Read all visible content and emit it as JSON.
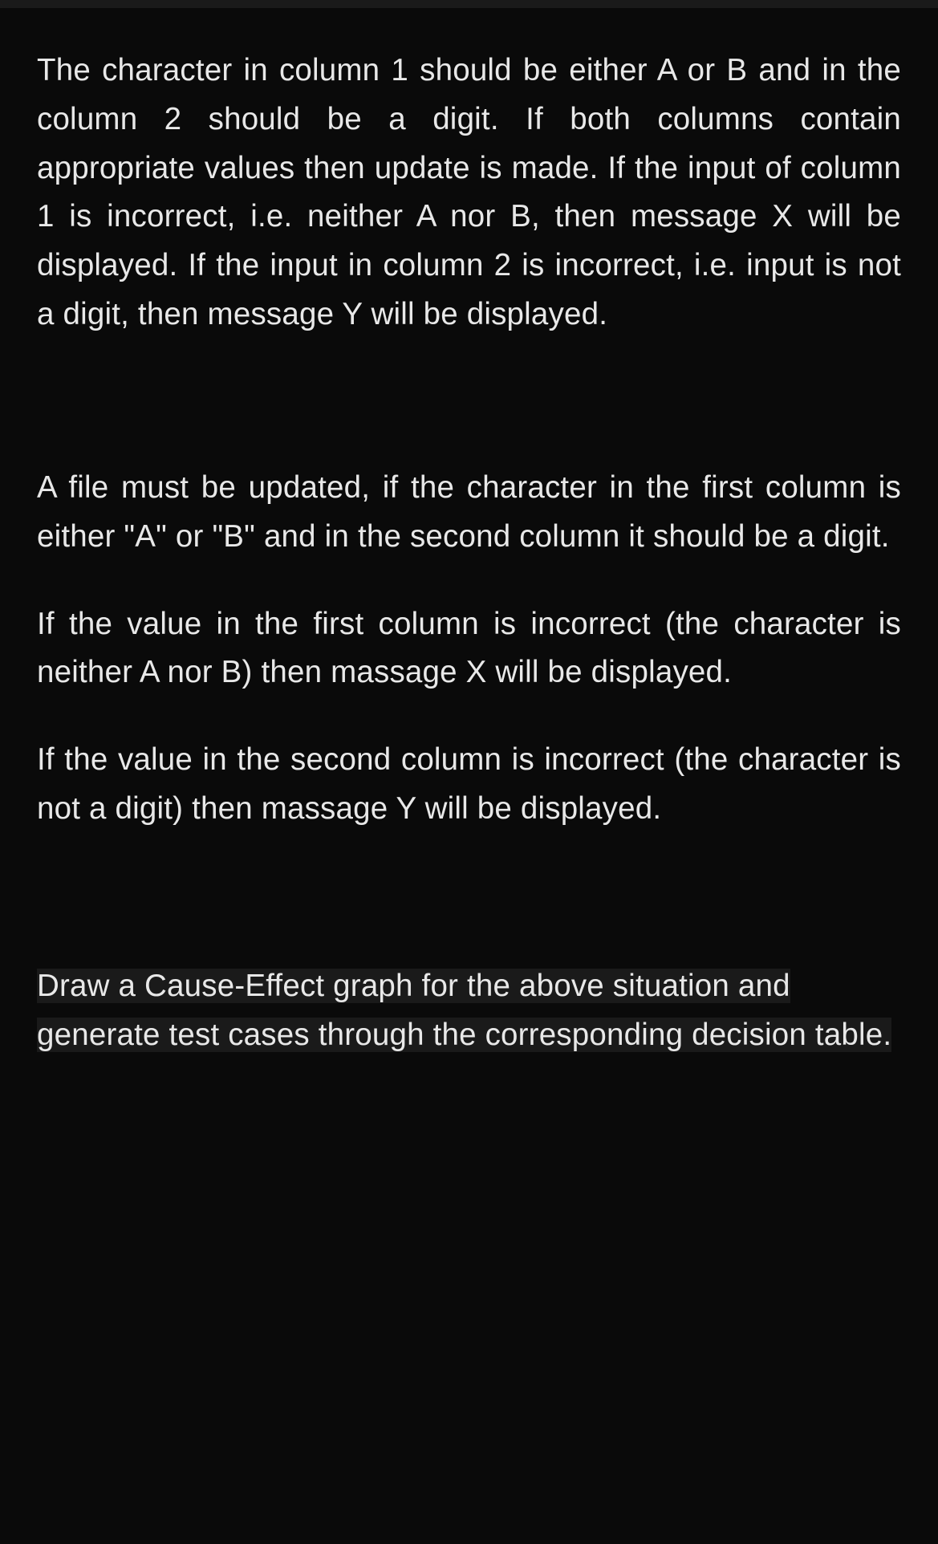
{
  "paragraphs": {
    "p1": "The character in column 1 should be either A or B and in the column 2 should be a digit. If both columns contain appropriate values then update is made. If the input of column 1 is incorrect, i.e. neither A nor B, then message X will be displayed. If the input in column 2 is incorrect, i.e. input is not a digit, then message Y will be displayed.",
    "p2": "A file must be updated, if the character in the first column is either \"A\" or \"B\" and in the second column it should be a digit.",
    "p3": "If the value in the first column is incorrect (the character is neither A nor B) then massage X will be displayed.",
    "p4": "If the value in the second column is incorrect (the character is not a digit) then massage Y will be displayed.",
    "task": "Draw a Cause-Effect graph for the above situation and generate test cases through the corresponding decision table."
  }
}
